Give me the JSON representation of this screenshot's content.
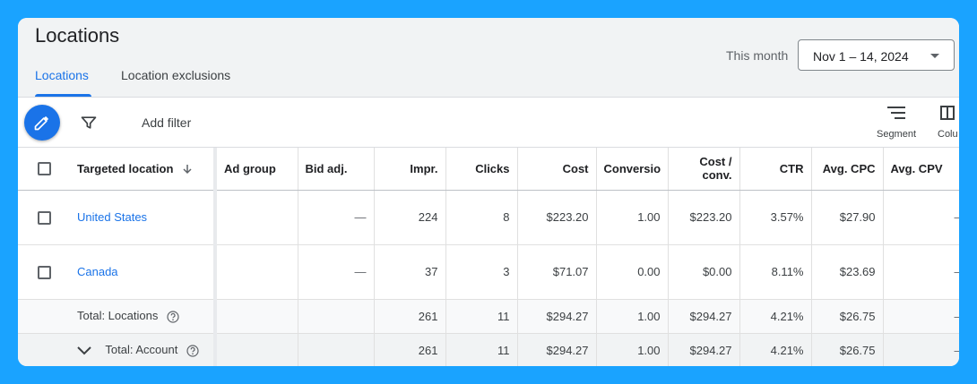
{
  "page": {
    "title": "Locations",
    "tabs": [
      {
        "label": "Locations",
        "active": true
      },
      {
        "label": "Location exclusions",
        "active": false
      }
    ],
    "date_range": {
      "label": "This month",
      "value": "Nov 1 – 14, 2024"
    }
  },
  "toolbar": {
    "add_filter": "Add filter",
    "segment": "Segment",
    "columns": "Colu"
  },
  "colors": {
    "accent": "#1a73e8",
    "background": "#1aa3ff"
  },
  "table": {
    "headers": {
      "location": "Targeted location",
      "ad_group": "Ad group",
      "bid_adj": "Bid adj.",
      "impr": "Impr.",
      "clicks": "Clicks",
      "cost": "Cost",
      "conversions": "Conversio",
      "cost_conv_1": "Cost /",
      "cost_conv_2": "conv.",
      "ctr": "CTR",
      "avg_cpc": "Avg. CPC",
      "avg_cpv": "Avg. CPV"
    },
    "rows": [
      {
        "location": "United States",
        "ad_group": "",
        "bid_adj": "—",
        "impr": "224",
        "clicks": "8",
        "cost": "$223.20",
        "conversions": "1.00",
        "cost_conv": "$223.20",
        "ctr": "3.57%",
        "avg_cpc": "$27.90",
        "avg_cpv": "—"
      },
      {
        "location": "Canada",
        "ad_group": "",
        "bid_adj": "—",
        "impr": "37",
        "clicks": "3",
        "cost": "$71.07",
        "conversions": "0.00",
        "cost_conv": "$0.00",
        "ctr": "8.11%",
        "avg_cpc": "$23.69",
        "avg_cpv": "—"
      }
    ],
    "totals": [
      {
        "label": "Total: Locations",
        "impr": "261",
        "clicks": "11",
        "cost": "$294.27",
        "conversions": "1.00",
        "cost_conv": "$294.27",
        "ctr": "4.21%",
        "avg_cpc": "$26.75",
        "avg_cpv": "—"
      },
      {
        "label": "Total: Account",
        "impr": "261",
        "clicks": "11",
        "cost": "$294.27",
        "conversions": "1.00",
        "cost_conv": "$294.27",
        "ctr": "4.21%",
        "avg_cpc": "$26.75",
        "avg_cpv": "—"
      }
    ]
  }
}
